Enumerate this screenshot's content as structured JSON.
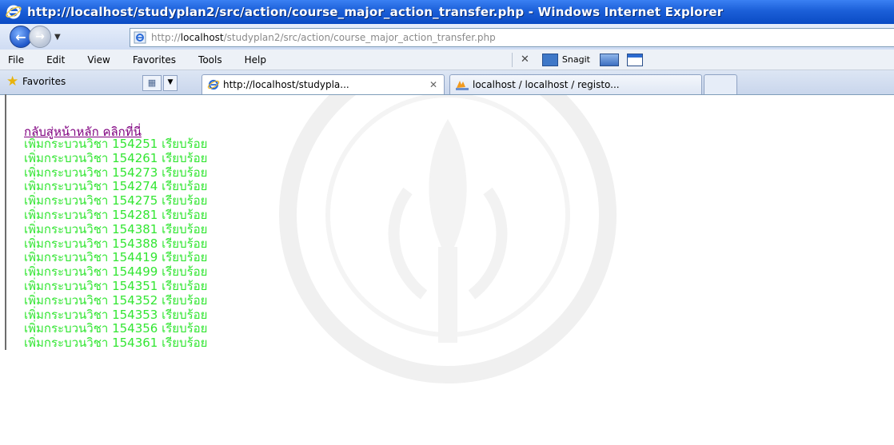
{
  "window": {
    "title": "http://localhost/studyplan2/src/action/course_major_action_transfer.php - Windows Internet Explorer"
  },
  "address_bar": {
    "url_prefix": "http://",
    "url_host": "localhost",
    "url_path": "/studyplan2/src/action/course_major_action_transfer.php"
  },
  "menu": {
    "items": [
      "File",
      "Edit",
      "View",
      "Favorites",
      "Tools",
      "Help"
    ],
    "snagit_label": "Snagit"
  },
  "tabs": {
    "favorites_label": "Favorites",
    "active_tab_label": "http://localhost/studypla...",
    "close_glyph": "✕",
    "inactive_tab_label": "localhost / localhost / registo..."
  },
  "content": {
    "home_link": "กลับสู่หน้าหลัก คลิกที่นี่",
    "status_lines": [
      "เพิ่มกระบวนวิชา 154251 เรียบร้อย",
      "เพิ่มกระบวนวิชา 154261 เรียบร้อย",
      "เพิ่มกระบวนวิชา 154273 เรียบร้อย",
      "เพิ่มกระบวนวิชา 154274 เรียบร้อย",
      "เพิ่มกระบวนวิชา 154275 เรียบร้อย",
      "เพิ่มกระบวนวิชา 154281 เรียบร้อย",
      "เพิ่มกระบวนวิชา 154381 เรียบร้อย",
      "เพิ่มกระบวนวิชา 154388 เรียบร้อย",
      "เพิ่มกระบวนวิชา 154419 เรียบร้อย",
      "เพิ่มกระบวนวิชา 154499 เรียบร้อย",
      "เพิ่มกระบวนวิชา 154351 เรียบร้อย",
      "เพิ่มกระบวนวิชา 154352 เรียบร้อย",
      "เพิ่มกระบวนวิชา 154353 เรียบร้อย",
      "เพิ่มกระบวนวิชา 154356 เรียบร้อย",
      "เพิ่มกระบวนวิชา 154361 เรียบร้อย"
    ]
  },
  "colors": {
    "title_bar": "#1b5fd8",
    "link_visited": "#800080",
    "success_text": "#33e633"
  }
}
